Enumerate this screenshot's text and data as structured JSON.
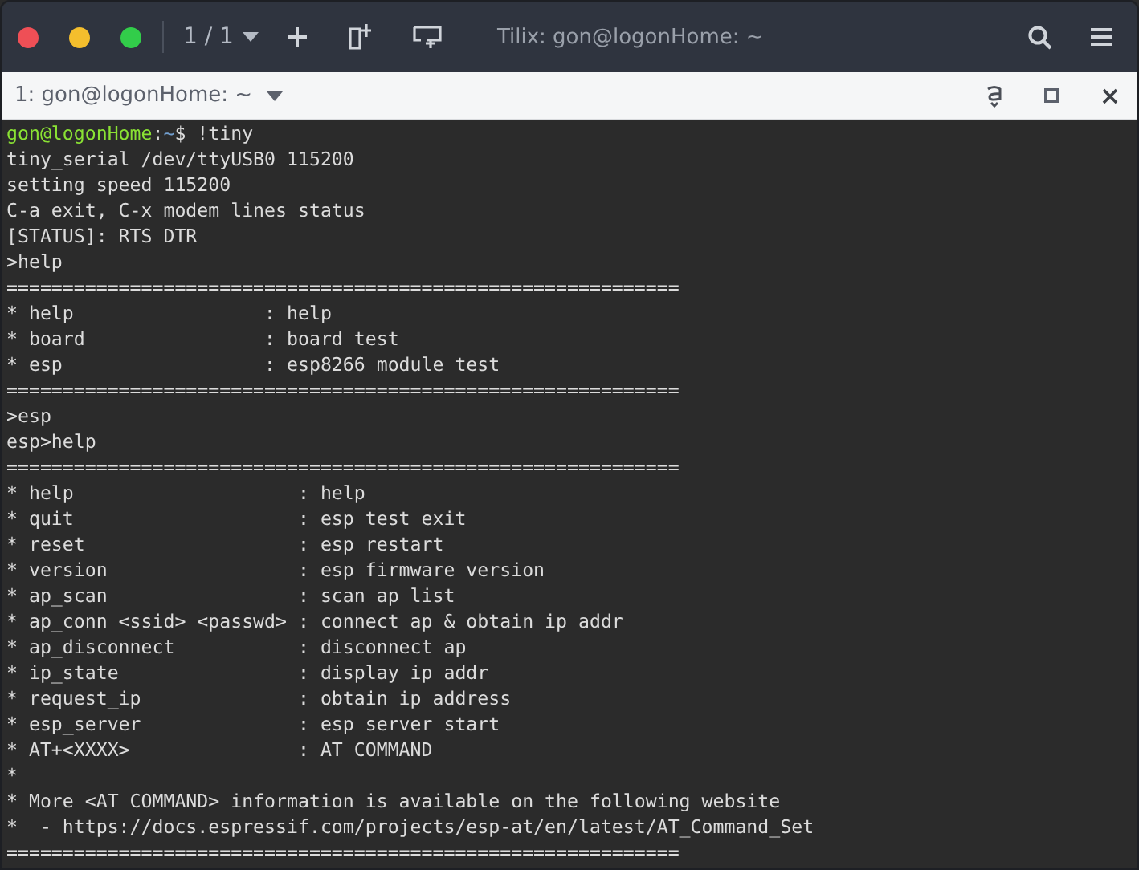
{
  "window": {
    "title": "Tilix: gon@logonHome: ~",
    "session_counter": "1 / 1"
  },
  "terminal_header": {
    "title": "1: gon@logonHome: ~"
  },
  "terminal": {
    "lines": [
      {
        "kind": "prompt",
        "user_host": "gon@logonHome",
        "separator": ":",
        "path": "~",
        "command": "$ !tiny"
      },
      {
        "kind": "output",
        "text": "tiny_serial /dev/ttyUSB0 115200"
      },
      {
        "kind": "output",
        "text": "setting speed 115200"
      },
      {
        "kind": "output",
        "text": "C-a exit, C-x modem lines status"
      },
      {
        "kind": "output",
        "text": "[STATUS]: RTS DTR"
      },
      {
        "kind": "output",
        "text": ">help"
      },
      {
        "kind": "output",
        "text": "============================================================"
      },
      {
        "kind": "output",
        "text": "* help                 : help"
      },
      {
        "kind": "output",
        "text": "* board                : board test"
      },
      {
        "kind": "output",
        "text": "* esp                  : esp8266 module test"
      },
      {
        "kind": "output",
        "text": "============================================================"
      },
      {
        "kind": "output",
        "text": ">esp"
      },
      {
        "kind": "output",
        "text": "esp>help"
      },
      {
        "kind": "output",
        "text": "============================================================"
      },
      {
        "kind": "output",
        "text": "* help                    : help"
      },
      {
        "kind": "output",
        "text": "* quit                    : esp test exit"
      },
      {
        "kind": "output",
        "text": "* reset                   : esp restart"
      },
      {
        "kind": "output",
        "text": "* version                 : esp firmware version"
      },
      {
        "kind": "output",
        "text": "* ap_scan                 : scan ap list"
      },
      {
        "kind": "output",
        "text": "* ap_conn <ssid> <passwd> : connect ap & obtain ip addr"
      },
      {
        "kind": "output",
        "text": "* ap_disconnect           : disconnect ap"
      },
      {
        "kind": "output",
        "text": "* ip_state                : display ip addr"
      },
      {
        "kind": "output",
        "text": "* request_ip              : obtain ip address"
      },
      {
        "kind": "output",
        "text": "* esp_server              : esp server start"
      },
      {
        "kind": "output",
        "text": "* AT+<XXXX>               : AT COMMAND"
      },
      {
        "kind": "output",
        "text": "*"
      },
      {
        "kind": "output",
        "text": "* More <AT COMMAND> information is available on the following website"
      },
      {
        "kind": "output",
        "text": "*  - https://docs.espressif.com/projects/esp-at/en/latest/AT_Command_Set"
      },
      {
        "kind": "output",
        "text": "============================================================"
      }
    ]
  }
}
